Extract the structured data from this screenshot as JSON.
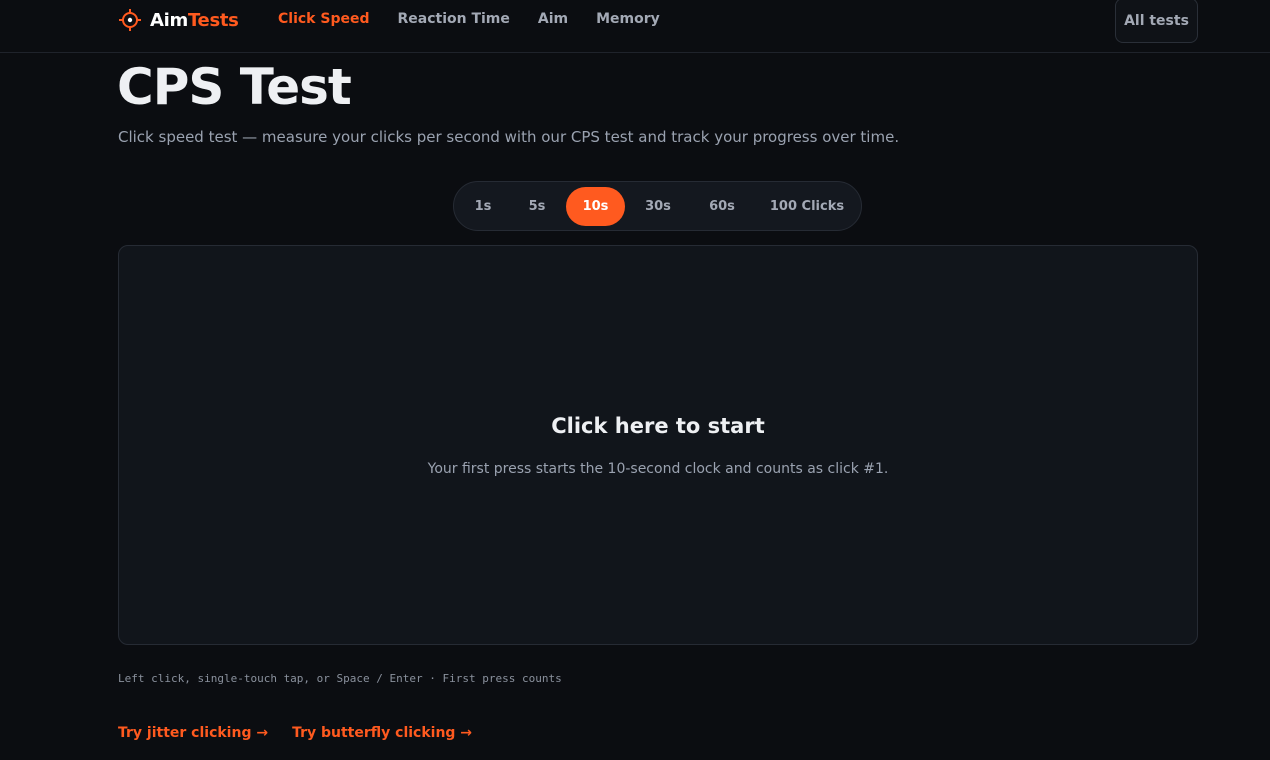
{
  "brand": {
    "part1": "Aim",
    "part2": "Tests",
    "accent": "#ff5a1f",
    "icon": "crosshair-icon"
  },
  "nav": {
    "items": [
      {
        "label": "Click Speed",
        "active": true
      },
      {
        "label": "Reaction Time",
        "active": false
      },
      {
        "label": "Aim",
        "active": false
      },
      {
        "label": "Memory",
        "active": false
      }
    ],
    "all_tests_label": "All tests"
  },
  "page": {
    "title": "CPS Test",
    "subtitle": "Click speed test — measure your clicks per second with our CPS test and track your progress over time."
  },
  "durations": {
    "options": [
      "1s",
      "5s",
      "10s",
      "30s",
      "60s",
      "100 Clicks"
    ],
    "selected": "10s"
  },
  "click_area": {
    "title": "Click here to start",
    "hint": "Your first press starts the 10-second clock and counts as click #1."
  },
  "input_note": "Left click, single-touch tap, or Space / Enter · First press counts",
  "links": [
    {
      "label": "Try jitter clicking →"
    },
    {
      "label": "Try butterfly clicking →"
    }
  ],
  "colors": {
    "background": "#0b0d11",
    "panel": "#11151b",
    "border": "#262b34",
    "muted_text": "#9aa2b0"
  }
}
